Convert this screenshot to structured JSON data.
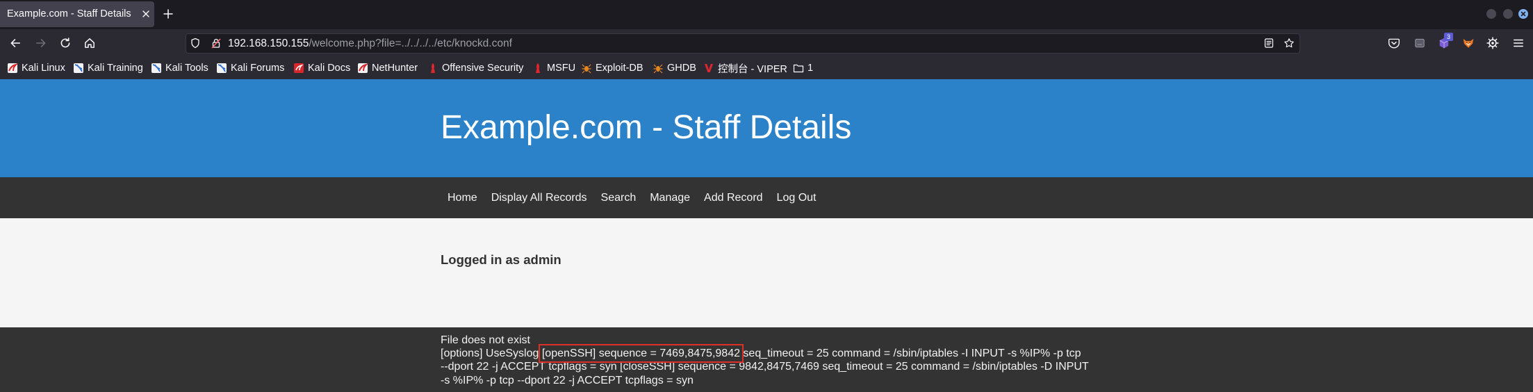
{
  "browser": {
    "tab_title": "Example.com - Staff Details",
    "url_host": "192.168.150.155",
    "url_path": "/welcome.php?file=../../../../etc/knockd.conf",
    "extension_badge": "3",
    "bookmarks": [
      {
        "label": "Kali Linux",
        "icon": "kali-linux-icon"
      },
      {
        "label": "Kali Training",
        "icon": "kali-training-icon"
      },
      {
        "label": "Kali Tools",
        "icon": "kali-tools-icon"
      },
      {
        "label": "Kali Forums",
        "icon": "kali-forums-icon"
      },
      {
        "label": "Kali Docs",
        "icon": "kali-docs-icon"
      },
      {
        "label": "NetHunter",
        "icon": "nethunter-icon"
      },
      {
        "label": "Offensive Security",
        "icon": "offensive-security-icon"
      },
      {
        "label": "MSFU",
        "icon": "msfu-icon"
      },
      {
        "label": "Exploit-DB",
        "icon": "exploit-db-icon"
      },
      {
        "label": "GHDB",
        "icon": "ghdb-icon"
      },
      {
        "label": "控制台 - VIPER",
        "icon": "viper-icon"
      },
      {
        "label": "1",
        "icon": "folder-icon"
      }
    ]
  },
  "page": {
    "site_title": "Example.com - Staff Details",
    "nav": [
      "Home",
      "Display All Records",
      "Search",
      "Manage",
      "Add Record",
      "Log Out"
    ],
    "login_status": "Logged in as admin",
    "output": {
      "error": "File does not exist",
      "line_1_before": "[options] UseSyslog ",
      "line_1_highlight": "[openSSH] sequence = 7469,8475,9842",
      "line_1_after": " seq_timeout = 25 command = /sbin/iptables -I INPUT -s %IP% -p tcp",
      "line_2": "--dport 22 -j ACCEPT tcpflags = syn [closeSSH] sequence = 9842,8475,7469 seq_timeout = 25 command = /sbin/iptables -D INPUT",
      "line_3": "-s %IP% -p tcp --dport 22 -j ACCEPT tcpflags = syn"
    }
  },
  "colors": {
    "header_blue": "#2c82c9",
    "nav_dark": "#333333",
    "body_light": "#f5f5f5",
    "footer_dark": "#333333",
    "highlight_red": "#dc3028"
  }
}
